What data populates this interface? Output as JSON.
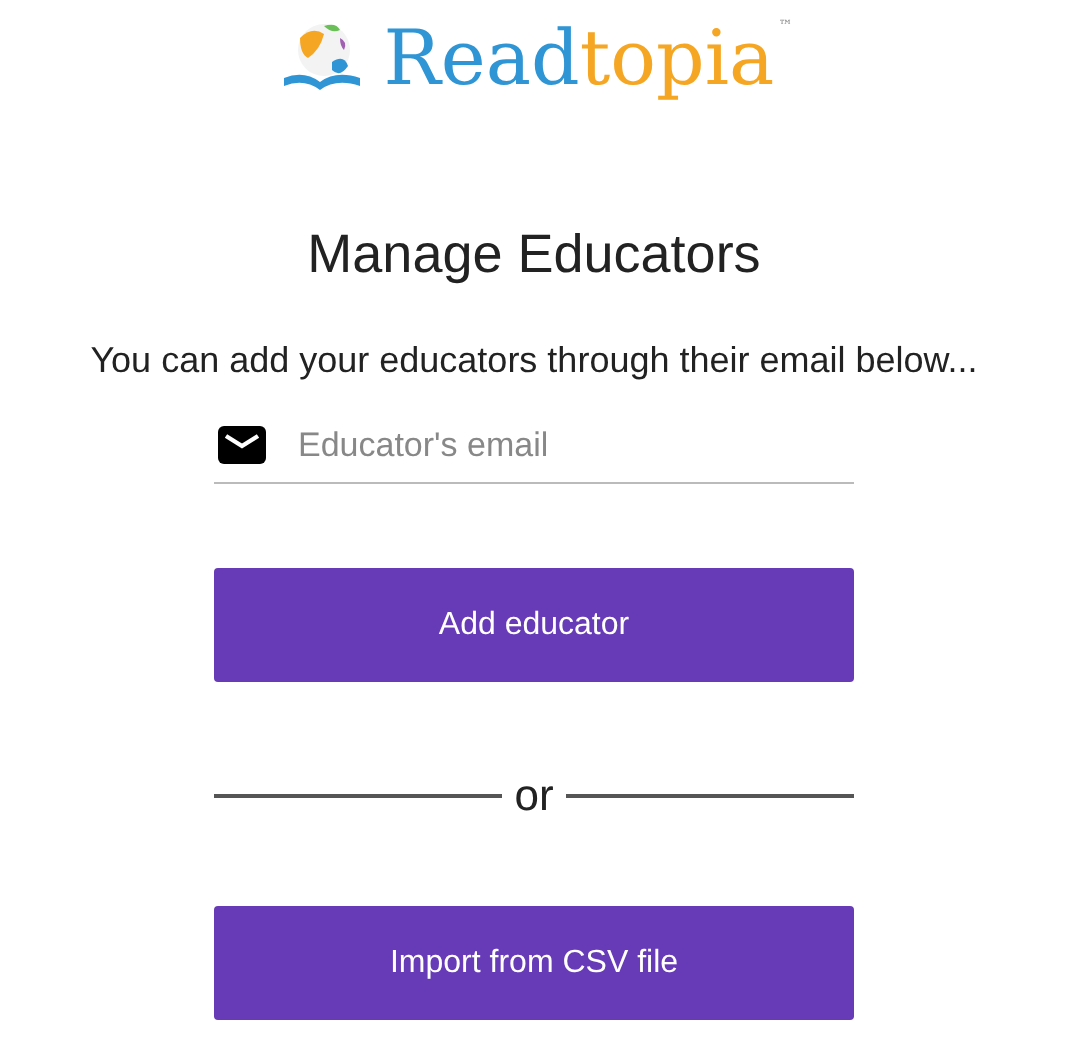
{
  "logo": {
    "first": "Read",
    "second": "topia",
    "mark": "™"
  },
  "title": "Manage Educators",
  "subtitle": "You can add your educators through their email below...",
  "email_field": {
    "placeholder": "Educator's email"
  },
  "add_button": "Add educator",
  "divider": "or",
  "import_button": "Import from CSV file"
}
